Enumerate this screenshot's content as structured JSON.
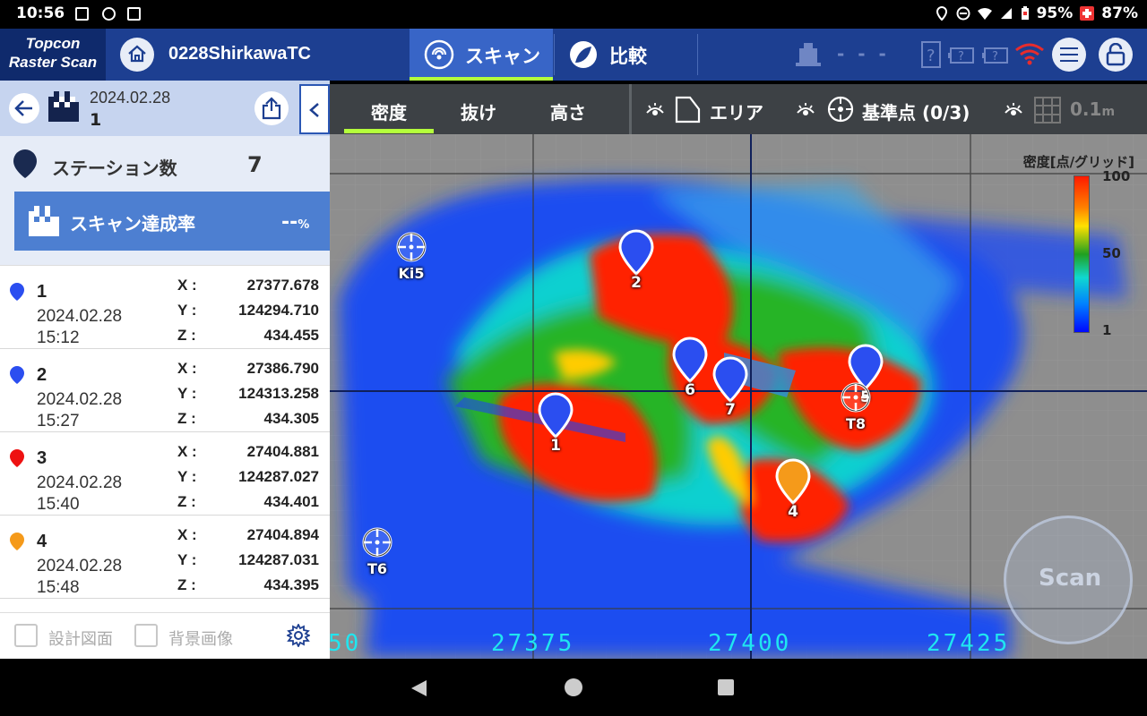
{
  "status_bar": {
    "time": "10:56",
    "battery1": "95%",
    "battery2": "87%"
  },
  "app": {
    "logo_line1": "Topcon",
    "logo_line2": "Raster Scan",
    "project": "0228ShirkawaTC"
  },
  "tabs": [
    {
      "label": "スキャン",
      "active": true
    },
    {
      "label": "比較",
      "active": false
    }
  ],
  "device_status": "- - -",
  "panel": {
    "date": "2024.02.28",
    "number": "1",
    "station_count_label": "ステーション数",
    "station_count": "7",
    "scan_rate_label": "スキャン達成率",
    "scan_rate_value": "--",
    "scan_rate_unit": "%",
    "stations": [
      {
        "id": "1",
        "date": "2024.02.28",
        "time": "15:12",
        "x": "27377.678",
        "y": "124294.710",
        "z": "434.455",
        "color": "#2b4ef0"
      },
      {
        "id": "2",
        "date": "2024.02.28",
        "time": "15:27",
        "x": "27386.790",
        "y": "124313.258",
        "z": "434.305",
        "color": "#2b4ef0"
      },
      {
        "id": "3",
        "date": "2024.02.28",
        "time": "15:40",
        "x": "27404.881",
        "y": "124287.027",
        "z": "434.401",
        "color": "#ee1111"
      },
      {
        "id": "4",
        "date": "2024.02.28",
        "time": "15:48",
        "x": "27404.894",
        "y": "124287.031",
        "z": "434.395",
        "color": "#f59a1a"
      }
    ],
    "coord_keys": {
      "x": "X :",
      "y": "Y :",
      "z": "Z :"
    },
    "design_drawing_label": "設計図面",
    "background_image_label": "背景画像"
  },
  "map": {
    "toolbar": {
      "density": "密度",
      "missing": "抜け",
      "height": "高さ",
      "area": "エリア",
      "reference": "基準点 (0/3)",
      "grid": "0.1",
      "grid_unit": "m"
    },
    "legend": {
      "title": "密度[点/グリッド]",
      "max": "100",
      "mid": "50",
      "min": "1"
    },
    "axis_labels": [
      "50",
      "27375",
      "27400",
      "27425"
    ],
    "stations": [
      {
        "label": "1",
        "color": "#2b4ef0"
      },
      {
        "label": "2",
        "color": "#2b4ef0"
      },
      {
        "label": "4",
        "color": "#f59a1a"
      },
      {
        "label": "5",
        "color": "#2b4ef0"
      },
      {
        "label": "6",
        "color": "#2b4ef0"
      },
      {
        "label": "7",
        "color": "#2b4ef0"
      }
    ],
    "reference_points": [
      "Ki5",
      "T6",
      "T8"
    ],
    "scan_button": "Scan"
  }
}
